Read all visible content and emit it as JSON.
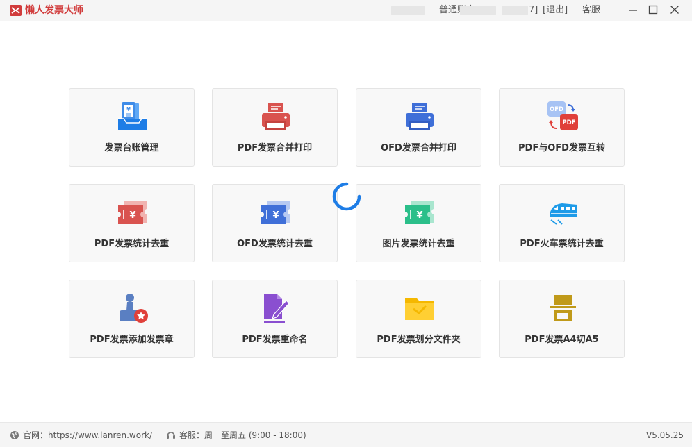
{
  "app": {
    "title": "懒人发票大师"
  },
  "titlebar": {
    "user_text": "普通账户 [ID:",
    "user_suffix": "7]",
    "logout_label": "[退出]",
    "support_label": "客服"
  },
  "tiles": [
    {
      "label": "发票台账管理",
      "icon": "ledger-icon"
    },
    {
      "label": "PDF发票合并打印",
      "icon": "printer-icon"
    },
    {
      "label": "OFD发票合并打印",
      "icon": "printer-icon"
    },
    {
      "label": "PDF与OFD发票互转",
      "icon": "convert-icon"
    },
    {
      "label": "PDF发票统计去重",
      "icon": "ticket-icon"
    },
    {
      "label": "OFD发票统计去重",
      "icon": "ticket-icon"
    },
    {
      "label": "图片发票统计去重",
      "icon": "ticket-icon"
    },
    {
      "label": "PDF火车票统计去重",
      "icon": "train-icon"
    },
    {
      "label": "PDF发票添加发票章",
      "icon": "stamp-icon"
    },
    {
      "label": "PDF发票重命名",
      "icon": "rename-icon"
    },
    {
      "label": "PDF发票划分文件夹",
      "icon": "folder-icon"
    },
    {
      "label": "PDF发票A4切A5",
      "icon": "cut-icon"
    }
  ],
  "convert_icon": {
    "ofd": "OFD",
    "pdf": "PDF"
  },
  "ticket_symbol": "¥",
  "footer": {
    "website_label": "官网：https://www.lanren.work/",
    "support_label": "客服：周一至周五 (9:00 - 18:00)",
    "version": "V5.05.25"
  },
  "colors": {
    "red": "#d9534f",
    "blue": "#3f6fd8",
    "green": "#2bbf8a",
    "sky": "#1e9be8",
    "purple": "#8a4fd0",
    "yellow": "#f5b800",
    "olive": "#c09a1a",
    "spinner": "#1e7de6"
  }
}
